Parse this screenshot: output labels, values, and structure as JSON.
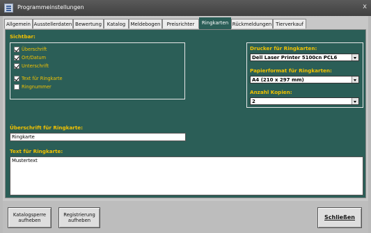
{
  "window": {
    "title": "Programmeinstellungen",
    "close": "x"
  },
  "tabs": [
    {
      "label": "Allgemein"
    },
    {
      "label": "Ausstellerdaten"
    },
    {
      "label": "Bewertung"
    },
    {
      "label": "Katalog"
    },
    {
      "label": "Meldebogen"
    },
    {
      "label": "Preisrichter"
    },
    {
      "label": "Ringkarten"
    },
    {
      "label": "Rückmeldungen"
    },
    {
      "label": "Tierverkauf"
    }
  ],
  "active_tab": "Ringkarten",
  "sichtbar": {
    "heading": "Sichtbar:",
    "items": [
      {
        "label": "Überschrift",
        "checked": true
      },
      {
        "label": "Ort/Datum",
        "checked": true
      },
      {
        "label": "Unterschrift",
        "checked": true
      },
      {
        "label": "Text für Ringkarte",
        "checked": true
      },
      {
        "label": "Ringnummer",
        "checked": false
      }
    ]
  },
  "printer": {
    "drucker_label": "Drucker für Ringkarten:",
    "drucker_value": "Dell Laser Printer 5100cn PCL6",
    "papier_label": "Papierformat für Ringkarten:",
    "papier_value": "A4 (210 x 297 mm)",
    "kopien_label": "Anzahl Kopien:",
    "kopien_value": "2"
  },
  "ueberschrift": {
    "label": "Überschrift für Ringkarte:",
    "value": "Ringkarte"
  },
  "text": {
    "label": "Text für Ringkarte:",
    "value": "Mustertext"
  },
  "buttons": {
    "katalogsperre_line1": "Katalogsperre",
    "katalogsperre_line2": "aufheben",
    "registrierung_line1": "Registrierung",
    "registrierung_line2": "aufheben",
    "schliessen": "Schließen"
  },
  "colors": {
    "panel": "#2b5e57",
    "label_yellow": "#f2c200",
    "titlebar": "#4a4a4a"
  }
}
